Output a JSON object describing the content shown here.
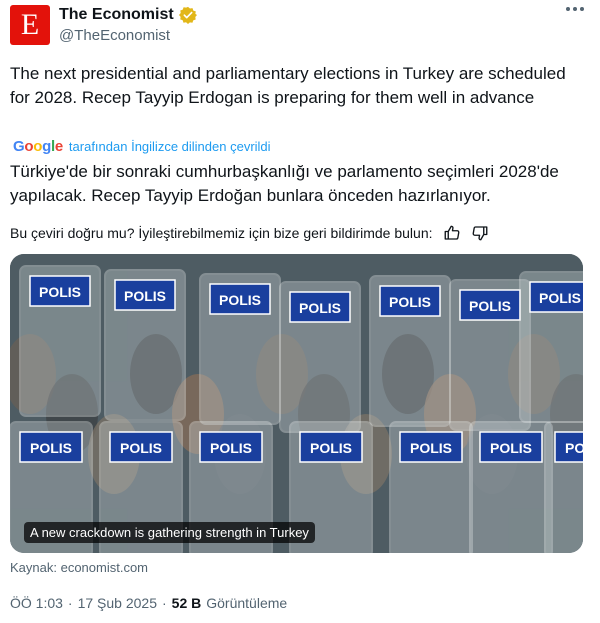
{
  "author": {
    "name": "The Economist",
    "handle": "@TheEconomist",
    "avatar_letter": "E",
    "brand_color": "#e3120b"
  },
  "tweet": {
    "text": "The next presidential and parliamentary elections in Turkey are scheduled for 2028. Recep Tayyip Erdogan is preparing for them well in advance",
    "translated_by_prefix": "Google",
    "translated_by_label": "tarafından İngilizce dilinden çevrildi",
    "translated_text": "Türkiye'de bir sonraki cumhurbaşkanlığı ve parlamento seçimleri 2028'de yapılacak. Recep Tayyip Erdoğan bunlara önceden hazırlanıyor.",
    "feedback_prompt": "Bu çeviri doğru mu? İyileştirebilmemiz için bize geri bildirimde bulun:"
  },
  "media": {
    "caption": "A new crackdown is gathering strength in Turkey",
    "shield_label": "POLIS",
    "shield_color": "#1a3f9e"
  },
  "source": "Kaynak: economist.com",
  "meta": {
    "time": "ÖÖ 1:03",
    "separator": "·",
    "date": "17 Şub 2025",
    "views_count": "52 B",
    "views_label": "Görüntüleme"
  },
  "icons": [
    "verified-badge-icon",
    "more-options-icon",
    "thumbs-up-icon",
    "thumbs-down-icon"
  ]
}
